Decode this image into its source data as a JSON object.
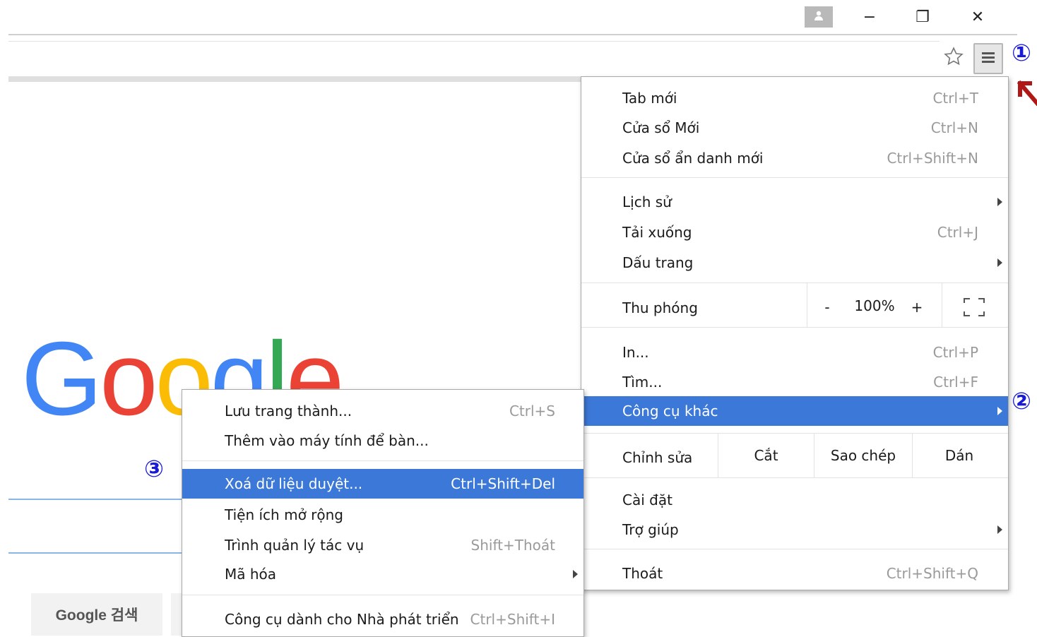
{
  "window": {
    "minimize": "−",
    "restore": "❐",
    "close": "✕"
  },
  "callouts": {
    "one": "①",
    "two": "②",
    "three": "③"
  },
  "google": {
    "search_button": "Google 검색"
  },
  "main_menu": {
    "items": [
      {
        "label": "Tab mới",
        "shortcut": "Ctrl+T"
      },
      {
        "label": "Cửa sổ Mới",
        "shortcut": "Ctrl+N"
      },
      {
        "label": "Cửa sổ ẩn danh mới",
        "shortcut": "Ctrl+Shift+N"
      },
      {
        "label": "Lịch sử",
        "shortcut": ""
      },
      {
        "label": "Tải xuống",
        "shortcut": "Ctrl+J"
      },
      {
        "label": "Dấu trang",
        "shortcut": ""
      },
      {
        "label": "In...",
        "shortcut": "Ctrl+P"
      },
      {
        "label": "Tìm...",
        "shortcut": "Ctrl+F"
      },
      {
        "label": "Công cụ khác",
        "shortcut": ""
      },
      {
        "label": "Cài đặt",
        "shortcut": ""
      },
      {
        "label": "Trợ giúp",
        "shortcut": ""
      },
      {
        "label": "Thoát",
        "shortcut": "Ctrl+Shift+Q"
      }
    ],
    "zoom": {
      "label": "Thu phóng",
      "minus": "-",
      "value": "100%",
      "plus": "+"
    },
    "edit": {
      "label": "Chỉnh sửa",
      "cut": "Cắt",
      "copy": "Sao chép",
      "paste": "Dán"
    }
  },
  "sub_menu": {
    "items": [
      {
        "label": "Lưu trang thành...",
        "shortcut": "Ctrl+S"
      },
      {
        "label": "Thêm vào máy tính để bàn...",
        "shortcut": ""
      },
      {
        "label": "Xoá dữ liệu duyệt...",
        "shortcut": "Ctrl+Shift+Del"
      },
      {
        "label": "Tiện ích mở rộng",
        "shortcut": ""
      },
      {
        "label": "Trình quản lý tác vụ",
        "shortcut": "Shift+Thoát"
      },
      {
        "label": "Mã hóa",
        "shortcut": ""
      },
      {
        "label": "Công cụ dành cho Nhà phát triển",
        "shortcut": "Ctrl+Shift+I"
      }
    ]
  },
  "colors": {
    "selection": "#3c78d8",
    "callout": "#1a1ad6",
    "arrow": "#b01818"
  },
  "icons": [
    "profile-icon",
    "star-icon",
    "hamburger-menu-icon",
    "fullscreen-icon",
    "arrow-icon"
  ]
}
